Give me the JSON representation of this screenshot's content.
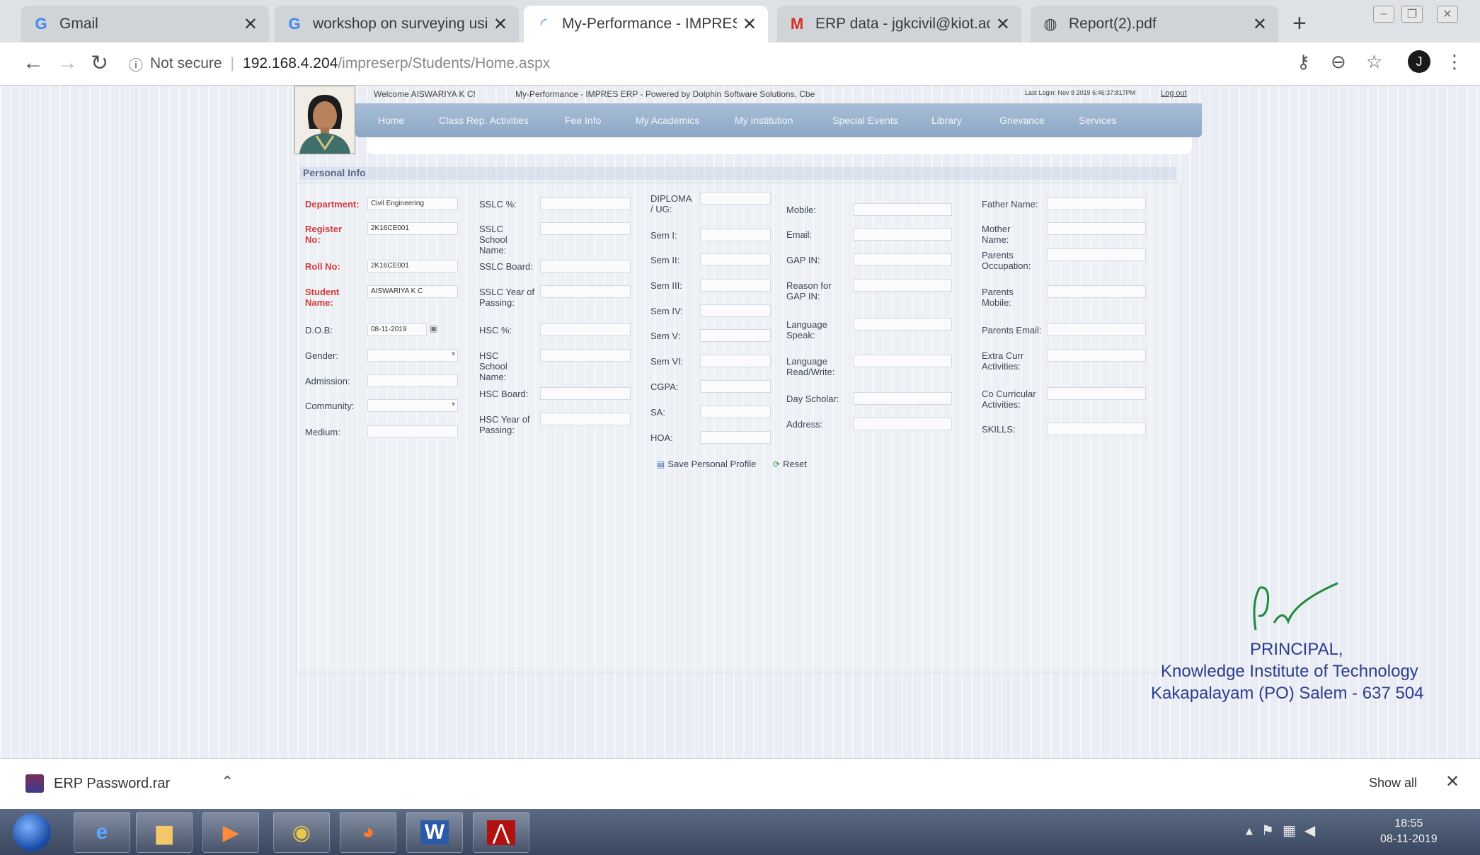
{
  "browser": {
    "tabs": [
      {
        "title": "Gmail",
        "icon": "google-g-icon"
      },
      {
        "title": "workshop on surveying using g",
        "icon": "google-g-icon"
      },
      {
        "title": "My-Performance - IMPRES ERP",
        "icon": "loading-icon",
        "active": true
      },
      {
        "title": "ERP data - jgkcivil@kiot.ac.in -",
        "icon": "gmail-m-icon"
      },
      {
        "title": "Report(2).pdf",
        "icon": "globe-icon"
      }
    ],
    "not_secure": "Not secure",
    "url_host": "192.168.4.204",
    "url_path": "/impreserp/Students/Home.aspx",
    "profile_initial": "J"
  },
  "header": {
    "welcome": "Welcome AISWARIYA K C!",
    "powered": "My-Performance - IMPRES ERP - Powered by Dolphin Software Solutions, Cbe",
    "last_login": "Last Login: Nov 8 2019 6:46:37:817PM",
    "logout": "Log out"
  },
  "nav": [
    "Home",
    "Class Rep. Activities",
    "Fee Info",
    "My Academics",
    "My Institution",
    "Special Events",
    "Library",
    "Grievance",
    "Services"
  ],
  "section_title": "Personal Info",
  "col1": {
    "department_label": "Department:",
    "department_value": "Civil Engineering",
    "register_label": "Register No:",
    "register_value": "2K16CE001",
    "roll_label": "Roll No:",
    "roll_value": "2K16CE001",
    "student_label": "Student Name:",
    "student_value": "AISWARIYA K C",
    "dob_label": "D.O.B:",
    "dob_value": "08-11-2019",
    "gender_label": "Gender:",
    "admission_label": "Admission:",
    "community_label": "Community:",
    "medium_label": "Medium:"
  },
  "col2": {
    "sslc_pct": "SSLC %:",
    "sslc_school": "SSLC School Name:",
    "sslc_board": "SSLC Board:",
    "sslc_year": "SSLC Year of Passing:",
    "hsc_pct": "HSC %:",
    "hsc_school": "HSC School Name:",
    "hsc_board": "HSC Board:",
    "hsc_year": "HSC Year of Passing:"
  },
  "col3": {
    "diploma": "DIPLOMA / UG:",
    "sem1": "Sem I:",
    "sem2": "Sem II:",
    "sem3": "Sem III:",
    "sem4": "Sem IV:",
    "sem5": "Sem V:",
    "sem6": "Sem VI:",
    "cgpa": "CGPA:",
    "sa": "SA:",
    "hoa": "HOA:"
  },
  "col4": {
    "mobile": "Mobile:",
    "email": "Email:",
    "gap": "GAP IN:",
    "reason": "Reason for GAP IN:",
    "lang_speak": "Language Speak:",
    "lang_rw": "Language Read/Write:",
    "day_scholar": "Day Scholar:",
    "address": "Address:"
  },
  "col5": {
    "father": "Father Name:",
    "mother": "Mother Name:",
    "occupation": "Parents Occupation:",
    "parents_mobile": "Parents Mobile:",
    "parents_email": "Parents Email:",
    "extra_curr": "Extra Curr Activities:",
    "co_curr": "Co Curricular Activities:",
    "skills": "SKILLS:"
  },
  "buttons": {
    "save": "Save Personal Profile",
    "reset": "Reset"
  },
  "stamp": {
    "line1": "PRINCIPAL,",
    "line2": "Knowledge Institute of Technology",
    "line3": "Kakapalayam (PO) Salem - 637 504"
  },
  "download": {
    "file": "ERP Password.rar",
    "show_all": "Show all"
  },
  "taskbar": {
    "apps": [
      "internet-explorer-icon",
      "file-explorer-icon",
      "media-player-icon",
      "chrome-icon",
      "firefox-icon",
      "word-icon",
      "acrobat-icon"
    ],
    "time": "18:55",
    "date": "08-11-2019"
  }
}
